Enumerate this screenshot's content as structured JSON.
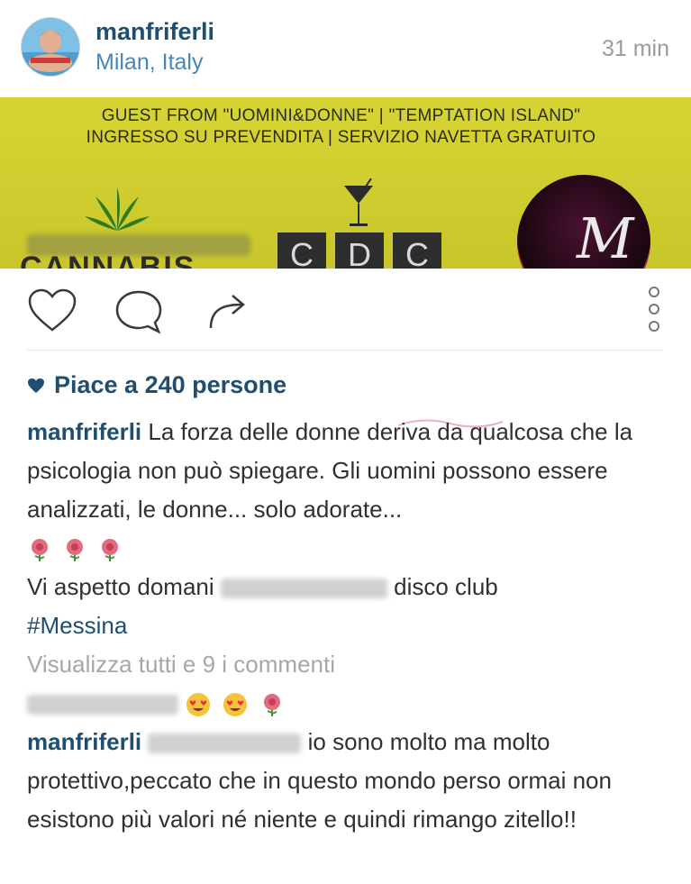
{
  "post": {
    "username": "manfriferli",
    "location": "Milan, Italy",
    "time": "31 min"
  },
  "banner": {
    "line1": "GUEST FROM \"UOMINI&DONNE\" | \"TEMPTATION ISLAND\"",
    "line2": "INGRESSO SU PREVENDITA | SERVIZIO NAVETTA GRATUITO",
    "logo_left": "CANNABIS",
    "logo_center": [
      "C",
      "D",
      "C"
    ],
    "logo_right": "M"
  },
  "likes": {
    "text": "Piace a 240 persone"
  },
  "caption": {
    "username": "manfriferli",
    "text": "La forza delle donne deriva da qualcosa che la psicologia non può spiegare. Gli uomini possono essere analizzati, le donne... solo adorate...",
    "line2_before": "Vi aspetto domani",
    "line2_after": "disco club",
    "hashtag": "#Messina"
  },
  "comments": {
    "view_all": "Visualizza tutti e 9 i commenti",
    "reply_username": "manfriferli",
    "reply_text": "io sono molto ma molto protettivo,peccato che in questo mondo perso ormai non esistono più valori né niente e quindi rimango zitello!!"
  },
  "colors": {
    "username": "#1f4e6e",
    "location": "#4a86b5",
    "banner": "#d7d434",
    "muted": "#9b9b9b"
  },
  "icons": [
    "heart-icon",
    "comment-icon",
    "share-icon",
    "more-options-icon",
    "small-heart-icon",
    "rose-icon",
    "heart-eyes-emoji-icon"
  ]
}
